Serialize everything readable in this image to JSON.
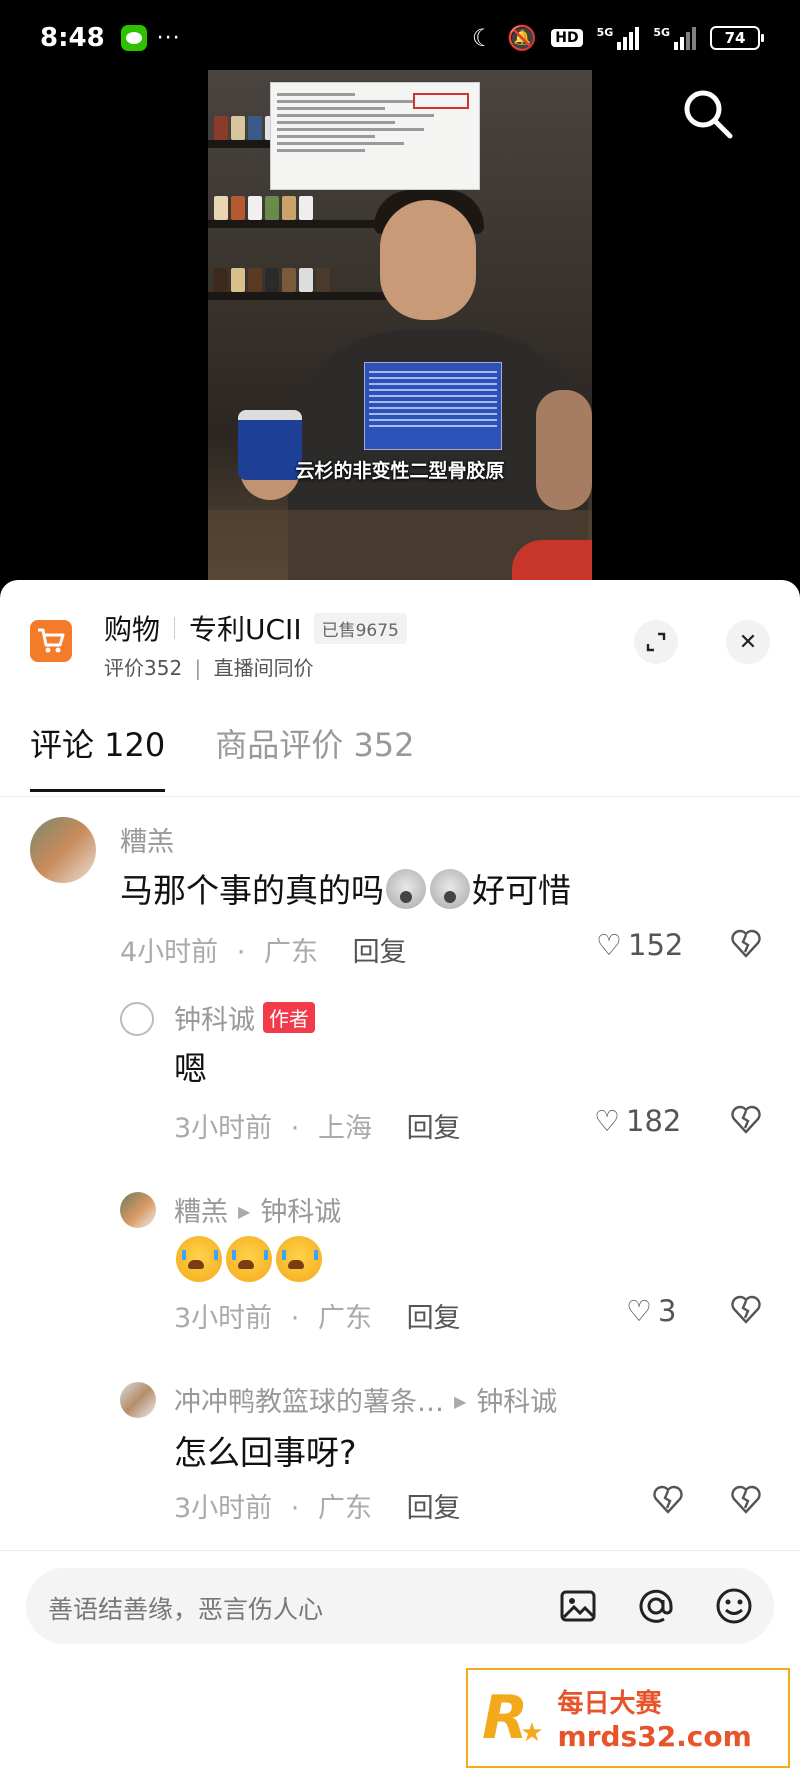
{
  "status_bar": {
    "time": "8:48",
    "dots": "···",
    "hd": "HD",
    "net1": "5G",
    "net2": "5G",
    "battery": "74"
  },
  "video": {
    "subtitle": "云杉的非变性二型骨胶原"
  },
  "shop": {
    "label": "购物",
    "product": "专利UCII",
    "sold": "已售9675",
    "rating": "评价352",
    "sub_sep": "|",
    "live_price": "直播间同价"
  },
  "tabs": [
    {
      "label": "评论 120"
    },
    {
      "label": "商品评价 352"
    }
  ],
  "comments": [
    {
      "name": "糟羔",
      "text_a": "马那个事的真的吗",
      "text_b": "好可惜",
      "time": "4小时前",
      "location": "广东",
      "reply": "回复",
      "likes": "152"
    },
    {
      "name": "钟科诚",
      "tag": "作者",
      "text": "嗯",
      "time": "3小时前",
      "location": "上海",
      "reply": "回复",
      "likes": "182"
    },
    {
      "name": "糟羔",
      "reply_to": "钟科诚",
      "time": "3小时前",
      "location": "广东",
      "reply": "回复",
      "likes": "3"
    },
    {
      "name": "冲冲鸭教篮球的薯条…",
      "reply_to": "钟科诚",
      "text": "怎么回事呀?",
      "time": "3小时前",
      "location": "广东",
      "reply": "回复"
    }
  ],
  "meta_sep": "·",
  "input": {
    "placeholder": "善语结善缘，恶言伤人心"
  },
  "watermark": {
    "logo": "R",
    "name": "每日大赛",
    "url": "mrds32.com"
  },
  "colors": {
    "accent_orange": "#f47b2a",
    "author_tag": "#f33a4b"
  }
}
